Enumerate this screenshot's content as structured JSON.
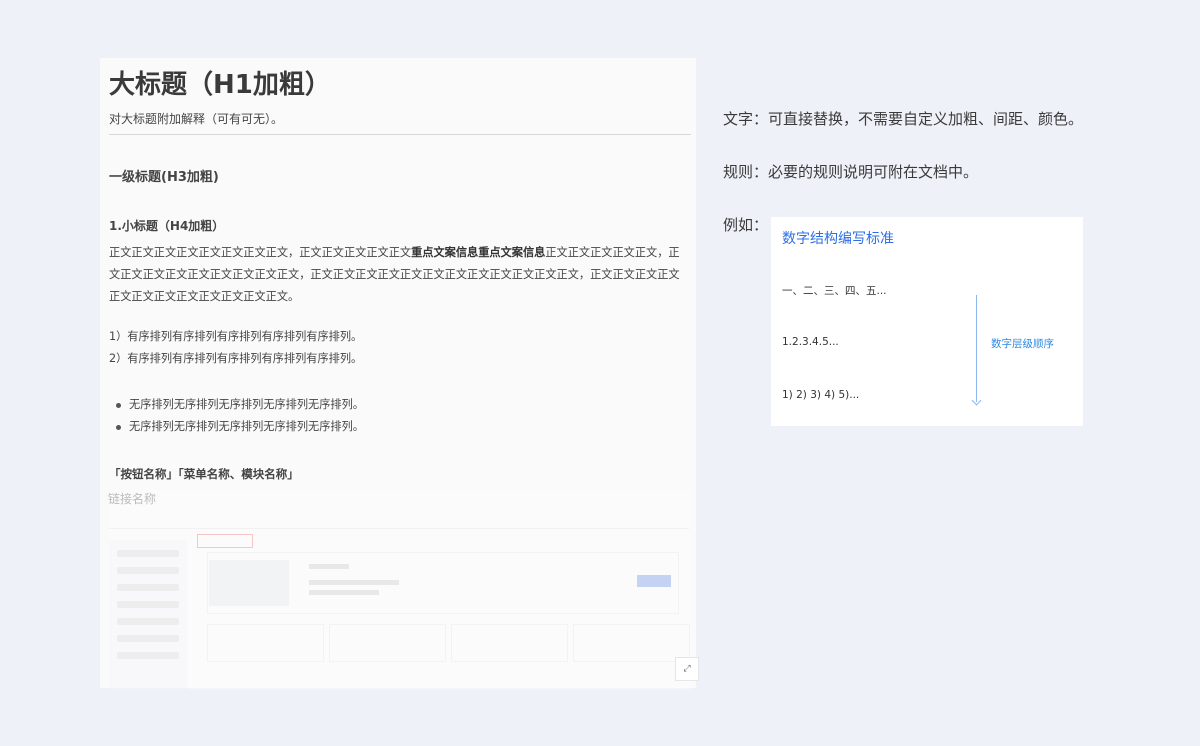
{
  "doc": {
    "h1": "大标题（H1加粗）",
    "h1_desc": "对大标题附加解释（可有可无）。",
    "h3": "一级标题(H3加粗)",
    "h4": "1.小标题（H4加粗）",
    "para_part1": "正文正文正文正文正文正文正文正文，正文正文正文正文正文",
    "para_bold": "重点文案信息重点文案信息",
    "para_part2": "正文正文正文正文正文，正文正文正文正文正文正文正文正文正文，正文正文正文正文正文正文正文正文正文正文正文正文，正文正文正文正文正文正文正文正文正文正文正文正文。",
    "ordered": [
      "1）有序排列有序排列有序排列有序排列有序排列。",
      "2）有序排列有序排列有序排列有序排列有序排列。"
    ],
    "unordered": [
      "无序排列无序排列无序排列无序排列无序排列。",
      "无序排列无序排列无序排列无序排列无序排列。"
    ],
    "button_names": "「按钮名称」「菜单名称、模块名称」",
    "link_name": "链接名称"
  },
  "rules": {
    "text": "文字：可直接替换，不需要自定义加粗、间距、颜色。",
    "rule": "规则：必要的规则说明可附在文档中。",
    "example": "例如："
  },
  "example_card": {
    "title": "数字结构编写标准",
    "levels": [
      "一、二、三、四、五...",
      "1.2.3.4.5...",
      "1) 2) 3) 4) 5)..."
    ],
    "arrow_label": "数字层级顺序",
    "accent": "#2f6fe6"
  }
}
